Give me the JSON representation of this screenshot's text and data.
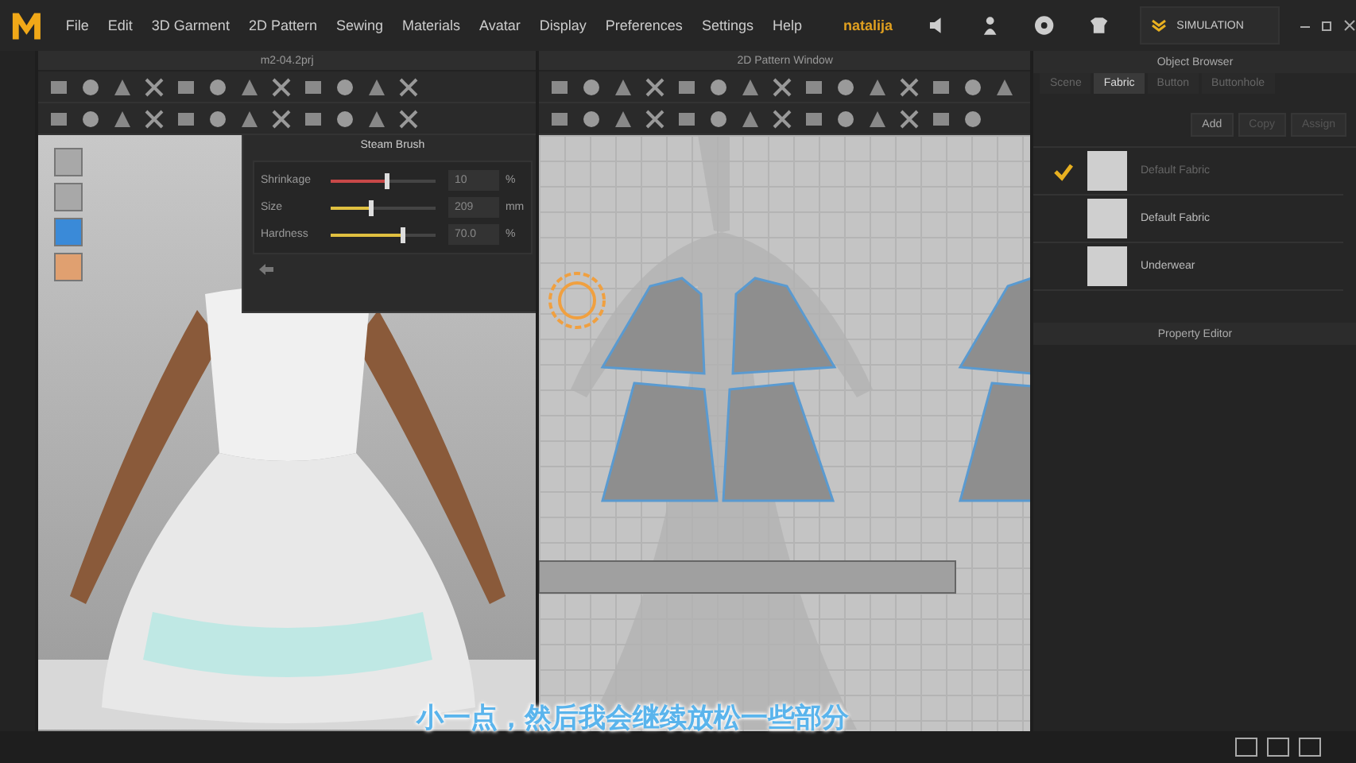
{
  "menu": [
    "File",
    "Edit",
    "3D Garment",
    "2D Pattern",
    "Sewing",
    "Materials",
    "Avatar",
    "Display",
    "Preferences",
    "Settings",
    "Help"
  ],
  "user": "natalija",
  "simulation": "SIMULATION",
  "view_3d": {
    "title": "m2-04.2prj"
  },
  "steam_brush": {
    "title": "Steam Brush",
    "sliders": [
      {
        "label": "Shrinkage",
        "color": "#c84848",
        "level": 0.52,
        "value": "10",
        "unit": "%"
      },
      {
        "label": "Size",
        "color": "#e0c040",
        "level": 0.36,
        "value": "209",
        "unit": "mm"
      },
      {
        "label": "Hardness",
        "color": "#e0c040",
        "level": 0.66,
        "value": "70.0",
        "unit": "%"
      }
    ]
  },
  "pattern_window": {
    "title": "2D Pattern Window"
  },
  "object_browser": {
    "title": "Object Browser",
    "tabs": [
      {
        "label": "Scene",
        "selected": false
      },
      {
        "label": "Fabric",
        "selected": true
      },
      {
        "label": "Button",
        "selected": false
      },
      {
        "label": "Buttonhole",
        "selected": false
      }
    ],
    "buttons": [
      {
        "label": "Add",
        "disabled": false
      },
      {
        "label": "Copy",
        "disabled": true
      },
      {
        "label": "Assign",
        "disabled": true
      }
    ],
    "fabrics": [
      {
        "name": "Default Fabric",
        "checked": true
      },
      {
        "name": "Default Fabric",
        "checked": false
      },
      {
        "name": "Underwear",
        "checked": false
      }
    ]
  },
  "property_editor": {
    "title": "Property Editor"
  },
  "subtitle": "小一点，然后我会继续放松一些部分"
}
